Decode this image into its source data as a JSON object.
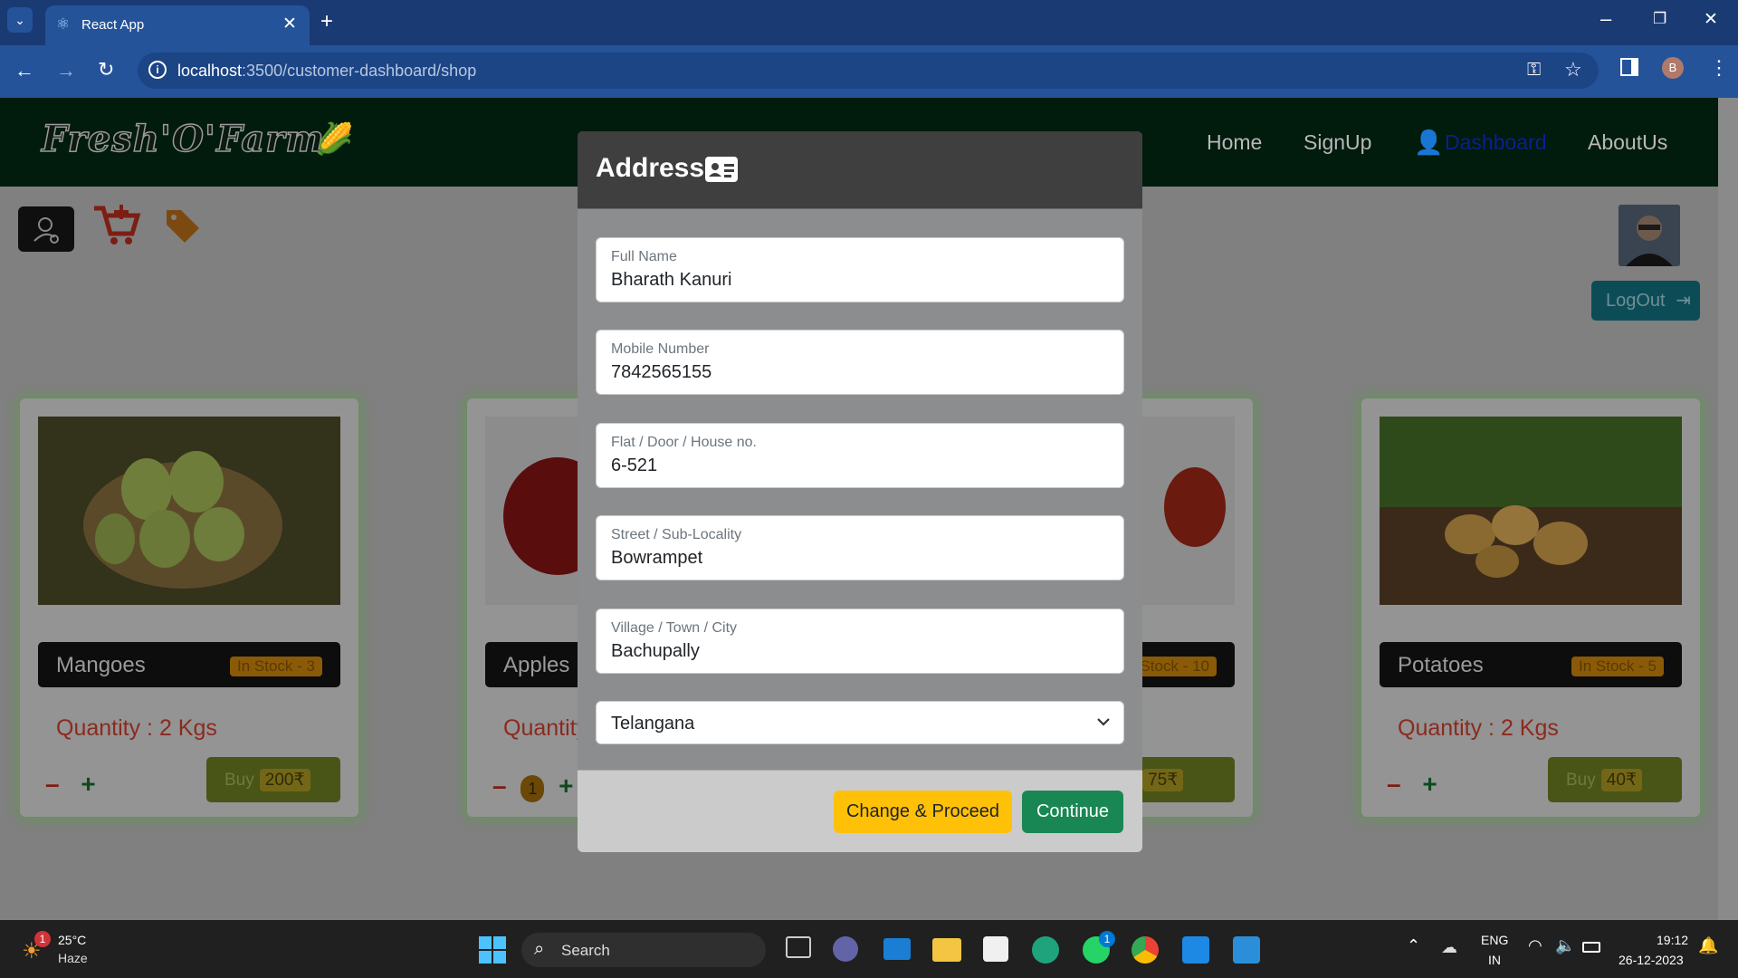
{
  "browser": {
    "tab_title": "React App",
    "url_host": "localhost",
    "url_rest": ":3500/customer-dashboard/shop",
    "profile_initial": "B"
  },
  "site": {
    "logo_text": "Fresh'O'Farm",
    "nav": {
      "home": "Home",
      "signup": "SignUp",
      "dashboard": "Dashboard",
      "aboutus": "AboutUs"
    },
    "logout_label": "LogOut"
  },
  "products": [
    {
      "name": "Mangoes",
      "stock": "In Stock - 3",
      "quantity": "Quantity : 2 Kgs",
      "buy": "Buy",
      "price": "200₹",
      "count": ""
    },
    {
      "name": "Apples",
      "stock": "",
      "quantity": "Quantity",
      "buy": "",
      "price": "",
      "count": "1"
    },
    {
      "name": "",
      "stock": "Stock - 10",
      "quantity": "",
      "buy": "uy",
      "price": "75₹",
      "count": ""
    },
    {
      "name": "Potatoes",
      "stock": "In Stock - 5",
      "quantity": "Quantity : 2 Kgs",
      "buy": "Buy",
      "price": "40₹",
      "count": ""
    }
  ],
  "modal": {
    "title": "Address",
    "fields": [
      {
        "label": "Full Name",
        "value": "Bharath Kanuri"
      },
      {
        "label": "Mobile Number",
        "value": "7842565155"
      },
      {
        "label": "Flat / Door / House no.",
        "value": "6-521"
      },
      {
        "label": "Street / Sub-Locality",
        "value": "Bowrampet"
      },
      {
        "label": "Village / Town / City",
        "value": "Bachupally"
      }
    ],
    "state_selected": "Telangana",
    "change_label": "Change & Proceed",
    "continue_label": "Continue"
  },
  "taskbar": {
    "weather_temp": "25°C",
    "weather_desc": "Haze",
    "weather_badge": "1",
    "search_label": "Search",
    "whatsapp_badge": "1",
    "lang_top": "ENG",
    "lang_bottom": "IN",
    "time": "19:12",
    "date": "26-12-2023"
  },
  "colors": {
    "modal_header": "#3f3f3f",
    "change_button": "#ffc107",
    "continue_button": "#198754",
    "logout_button": "#17a2b8"
  }
}
